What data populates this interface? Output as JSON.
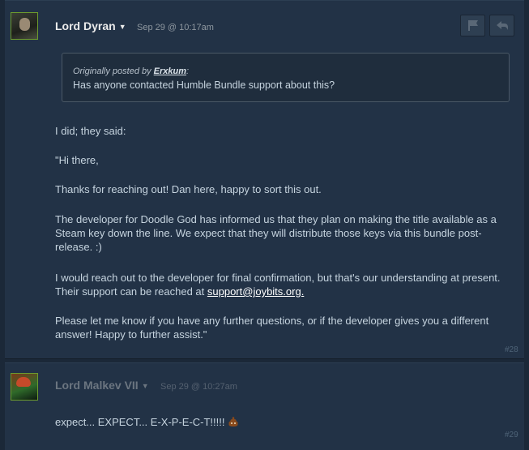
{
  "post1": {
    "author": "Lord Dyran",
    "timestamp": "Sep 29 @ 10:17am",
    "quote_prefix": "Originally posted by ",
    "quote_author": "Erxkum",
    "quote_suffix": ":",
    "quote_text": "Has anyone contacted Humble Bundle support about this?",
    "p1": "I did; they said:",
    "p2": "\"Hi there,",
    "p3": "Thanks for reaching out! Dan here, happy to sort this out.",
    "p4": "The developer for Doodle God has informed us that they plan on making the title available as a Steam key down the line. We expect that they will distribute those keys via this bundle post-release. :)",
    "p5_text": "I would reach out to the developer for final confirmation, but that's our understanding at present. Their support can be reached at ",
    "p5_link": "support@joybits.org.",
    "p6": "Please let me know if you have any further questions, or if the developer gives you a different answer! Happy to further assist.\"",
    "post_number": "#28"
  },
  "post2": {
    "author": "Lord Malkev VII",
    "timestamp": "Sep 29 @ 10:27am",
    "text": "expect... EXPECT... E-X-P-E-C-T!!!!!",
    "emoticon": "poop-emoticon",
    "post_number": "#29"
  },
  "icons": {
    "flag": "flag-icon",
    "reply": "reply-icon"
  },
  "colors": {
    "background": "#1b2838",
    "post_bg": "#223246",
    "avatar_border": "#6c9a2e"
  }
}
